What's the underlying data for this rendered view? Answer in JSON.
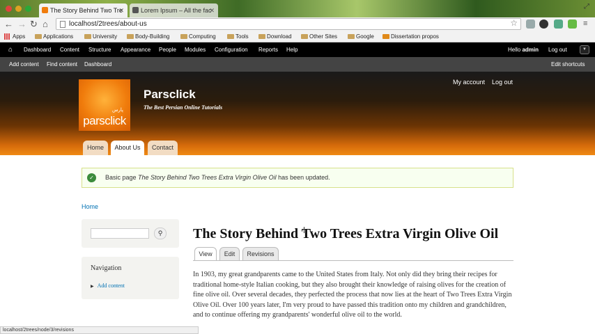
{
  "browser": {
    "tabs": [
      {
        "title": "The Story Behind Two Tre"
      },
      {
        "title": "Lorem Ipsum – All the fac"
      }
    ],
    "url": "localhost/2trees/about-us",
    "bookmarks": [
      "Apps",
      "Applications",
      "University",
      "Body-Building",
      "Computing",
      "Tools",
      "Download",
      "Other Sites",
      "Google",
      "Dissertation propos"
    ],
    "status_url": "localhost/2trees/node/3/revisions"
  },
  "admin": {
    "menu": [
      "Dashboard",
      "Content",
      "Structure",
      "Appearance",
      "People",
      "Modules",
      "Configuration",
      "Reports",
      "Help"
    ],
    "hello": "Hello ",
    "user": "admin",
    "logout": "Log out",
    "shortcuts": [
      "Add content",
      "Find content",
      "Dashboard"
    ],
    "edit_shortcuts": "Edit shortcuts"
  },
  "site": {
    "name": "Parsclick",
    "slogan": "The Best Persian Online Tutorials",
    "logo_text": "parsclick",
    "secondary": [
      "My account",
      "Log out"
    ],
    "main_menu": [
      "Home",
      "About Us",
      "Contact"
    ]
  },
  "messages": {
    "status_prefix": "Basic page ",
    "status_title": "The Story Behind Two Trees Extra Virgin Olive Oil",
    "status_suffix": " has been updated."
  },
  "breadcrumb": "Home",
  "sidebar": {
    "nav_title": "Navigation",
    "nav_item": "Add content"
  },
  "node": {
    "title": "The Story Behind Two Trees Extra Virgin Olive Oil",
    "tabs": [
      "View",
      "Edit",
      "Revisions"
    ],
    "body": "In 1903, my great grandparents came to the United States from Italy. Not only did they bring their recipes for traditional home-style Italian cooking, but they also brought their knowledge of raising olives for the creation of fine olive oil. Over several decades, they perfected the process that now lies at the heart of Two Trees Extra Virgin Olive Oil. Over 100 years later, I'm very proud to have passed this tradition onto my children and grandchildren, and to continue offering my grandparents' wonderful olive oil to the world."
  },
  "colors": {
    "link": "#0071b3",
    "header_orange": "#f08a14",
    "admin_bar": "#000000"
  }
}
